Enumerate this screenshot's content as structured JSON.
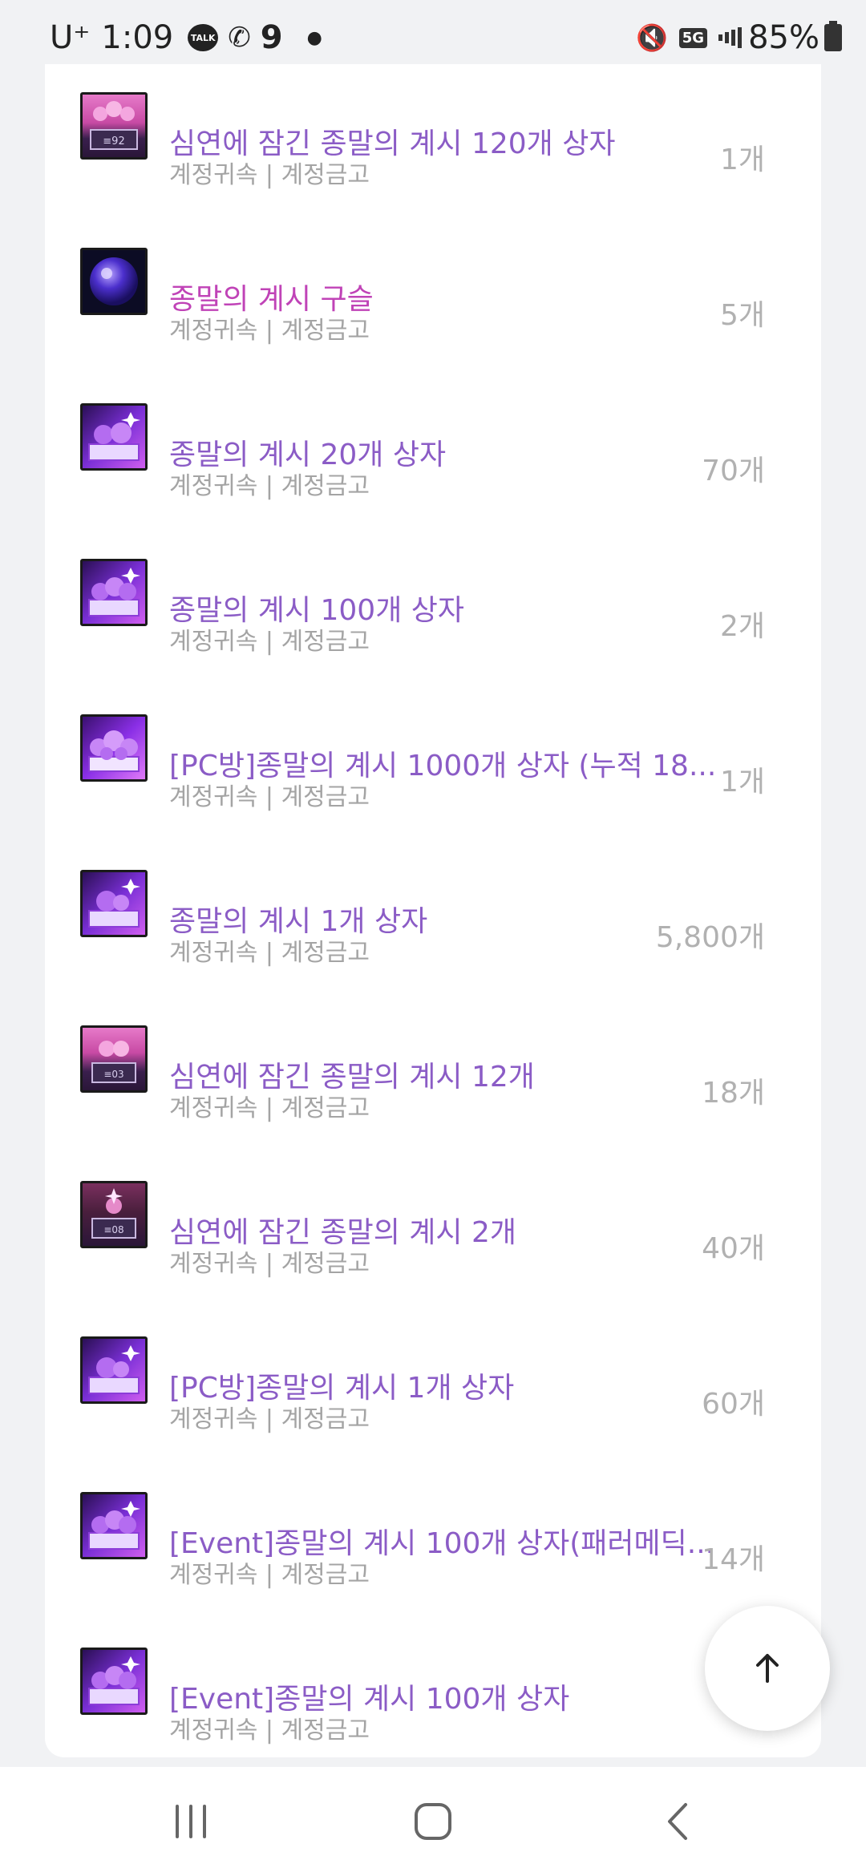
{
  "status_bar": {
    "carrier": "U⁺",
    "time": "1:09",
    "talk_badge": "TALK",
    "nine_badge": "9",
    "network": "5G",
    "battery": "85%"
  },
  "items_sub_label": "계정귀속 | 계정금고",
  "items": [
    {
      "name": "심연에 잠긴 종말의 계시 120개 상자",
      "sub": "계정귀속 | 계정금고",
      "count": "1개",
      "color": "#8b5cc6",
      "icon": "abyss-chest-icon"
    },
    {
      "name": "종말의 계시 구슬",
      "sub": "계정귀속 | 계정금고",
      "count": "5개",
      "color": "#c043b7",
      "icon": "orb-icon"
    },
    {
      "name": "종말의 계시 20개 상자",
      "sub": "계정귀속 | 계정금고",
      "count": "70개",
      "color": "#8b5cc6",
      "icon": "purple-chest-icon"
    },
    {
      "name": "종말의 계시 100개 상자",
      "sub": "계정귀속 | 계정금고",
      "count": "2개",
      "color": "#8b5cc6",
      "icon": "purple-chest-icon"
    },
    {
      "name": "[PC방]종말의 계시 1000개 상자 (누적 18...",
      "sub": "계정귀속 | 계정금고",
      "count": "1개",
      "color": "#8b5cc6",
      "icon": "purple-chest-icon"
    },
    {
      "name": "종말의 계시 1개 상자",
      "sub": "계정귀속 | 계정금고",
      "count": "5,800개",
      "color": "#8b5cc6",
      "icon": "purple-chest-icon"
    },
    {
      "name": "심연에 잠긴 종말의 계시 12개",
      "sub": "계정귀속 | 계정금고",
      "count": "18개",
      "color": "#8b5cc6",
      "icon": "abyss-chest-icon"
    },
    {
      "name": "심연에 잠긴 종말의 계시 2개",
      "sub": "계정귀속 | 계정금고",
      "count": "40개",
      "color": "#8b5cc6",
      "icon": "abyss-chest-icon"
    },
    {
      "name": "[PC방]종말의 계시 1개 상자",
      "sub": "계정귀속 | 계정금고",
      "count": "60개",
      "color": "#8b5cc6",
      "icon": "purple-chest-icon"
    },
    {
      "name": "[Event]종말의 계시 100개 상자(패러메딕...",
      "sub": "계정귀속 | 계정금고",
      "count": "14개",
      "color": "#8b5cc6",
      "icon": "purple-chest-icon"
    },
    {
      "name": "[Event]종말의 계시 100개 상자",
      "sub": "계정귀속 | 계정금고",
      "count": "",
      "color": "#8b5cc6",
      "icon": "purple-chest-icon"
    }
  ],
  "colors": {
    "accent_purple": "#8b5cc6",
    "accent_magenta": "#c043b7",
    "sub_gray": "#a4a4a4",
    "count_gray": "#b1b1b1"
  },
  "nav": {
    "recents_icon": "recents-icon",
    "home_icon": "home-icon",
    "back_icon": "back-icon"
  }
}
